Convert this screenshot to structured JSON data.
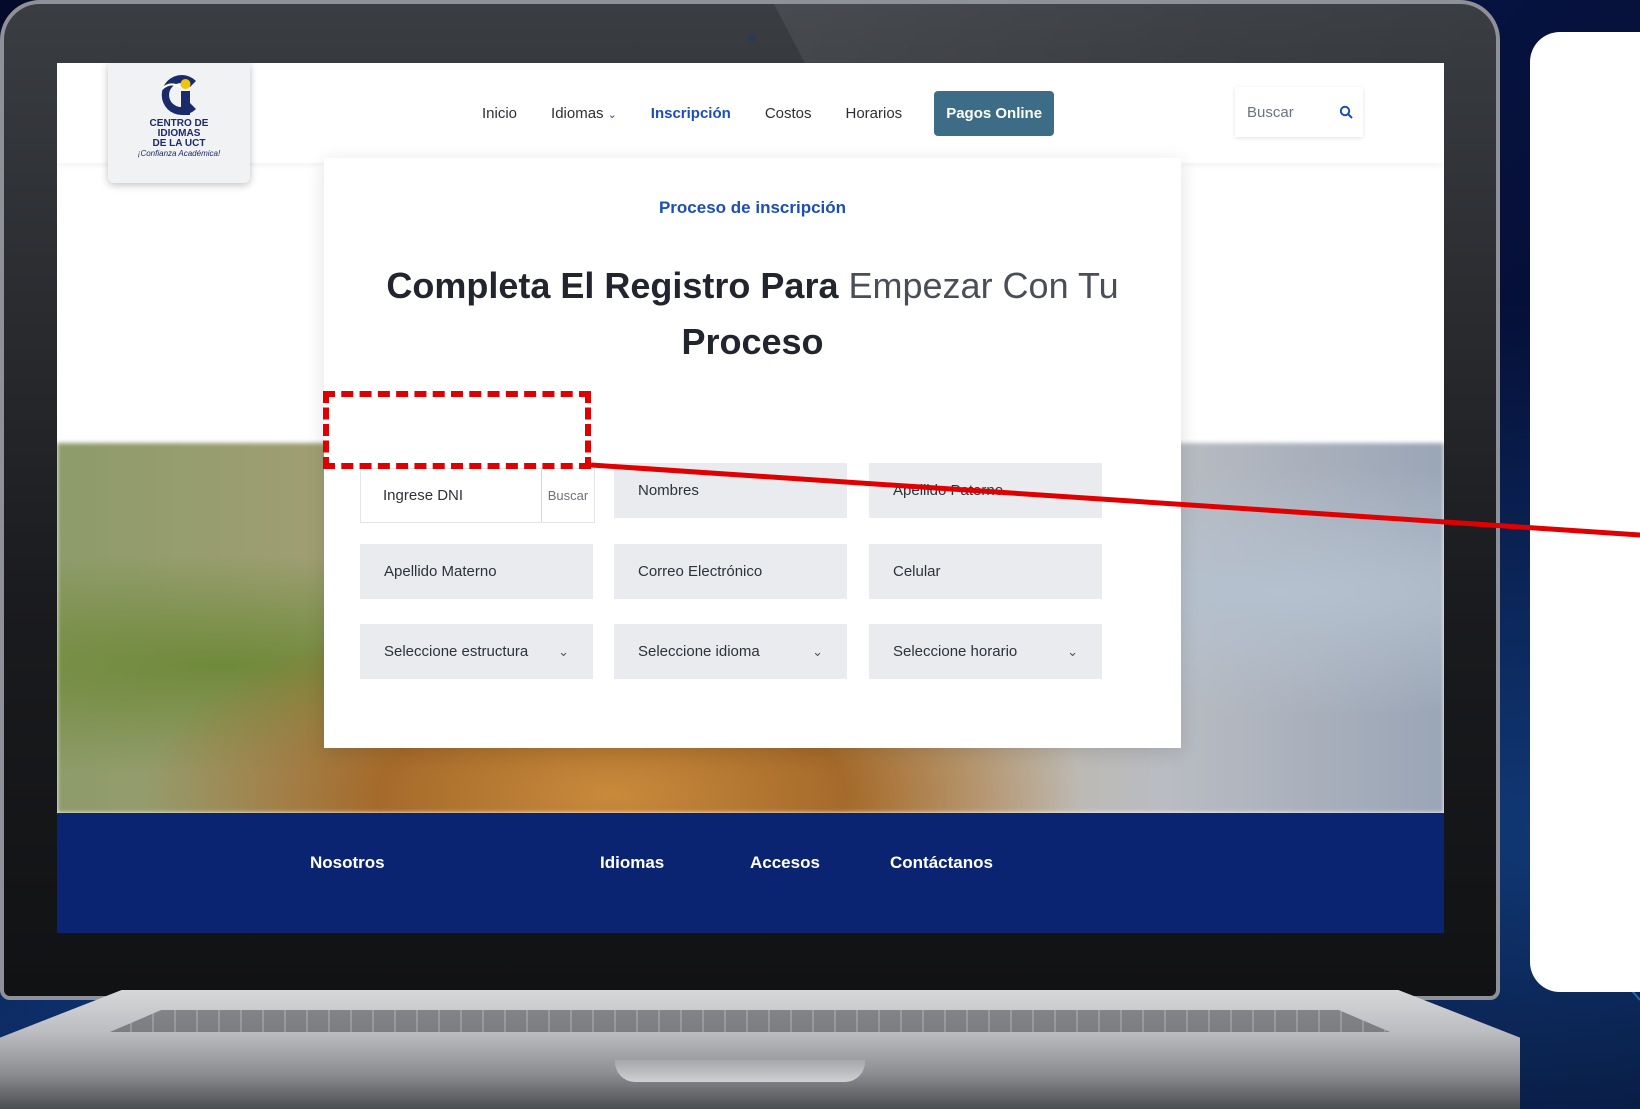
{
  "logo": {
    "line1": "CENTRO DE",
    "line2": "IDIOMAS",
    "line3": "DE LA UCT",
    "tagline": "¡Confianza Académica!"
  },
  "nav": {
    "items": [
      {
        "label": "Inicio",
        "active": false
      },
      {
        "label": "Idiomas",
        "active": false,
        "dropdown": true
      },
      {
        "label": "Inscripción",
        "active": true
      },
      {
        "label": "Costos",
        "active": false
      },
      {
        "label": "Horarios",
        "active": false
      }
    ],
    "pay_button": "Pagos Online",
    "search_placeholder": "Buscar"
  },
  "form": {
    "eyebrow": "Proceso de inscripción",
    "title_part1": "Completa El Registro Para ",
    "title_part2": "Empezar Con Tu",
    "title_part3": "Proceso",
    "dni_placeholder": "Ingrese DNI",
    "dni_button": "Buscar",
    "nombres": "Nombres",
    "apellido_paterno": "Apellido Paterno",
    "apellido_materno": "Apellido Materno",
    "correo": "Correo Electrónico",
    "celular": "Celular",
    "estructura": "Seleccione estructura",
    "idioma": "Seleccione idioma",
    "horario": "Seleccione horario"
  },
  "footer": {
    "nosotros": "Nosotros",
    "idiomas": "Idiomas",
    "accesos": "Accesos",
    "contactanos": "Contáctanos"
  },
  "colors": {
    "accent": "#1c4db8",
    "pay_button": "#3d6d86",
    "footer": "#0b2471",
    "annotation": "#e00000"
  }
}
